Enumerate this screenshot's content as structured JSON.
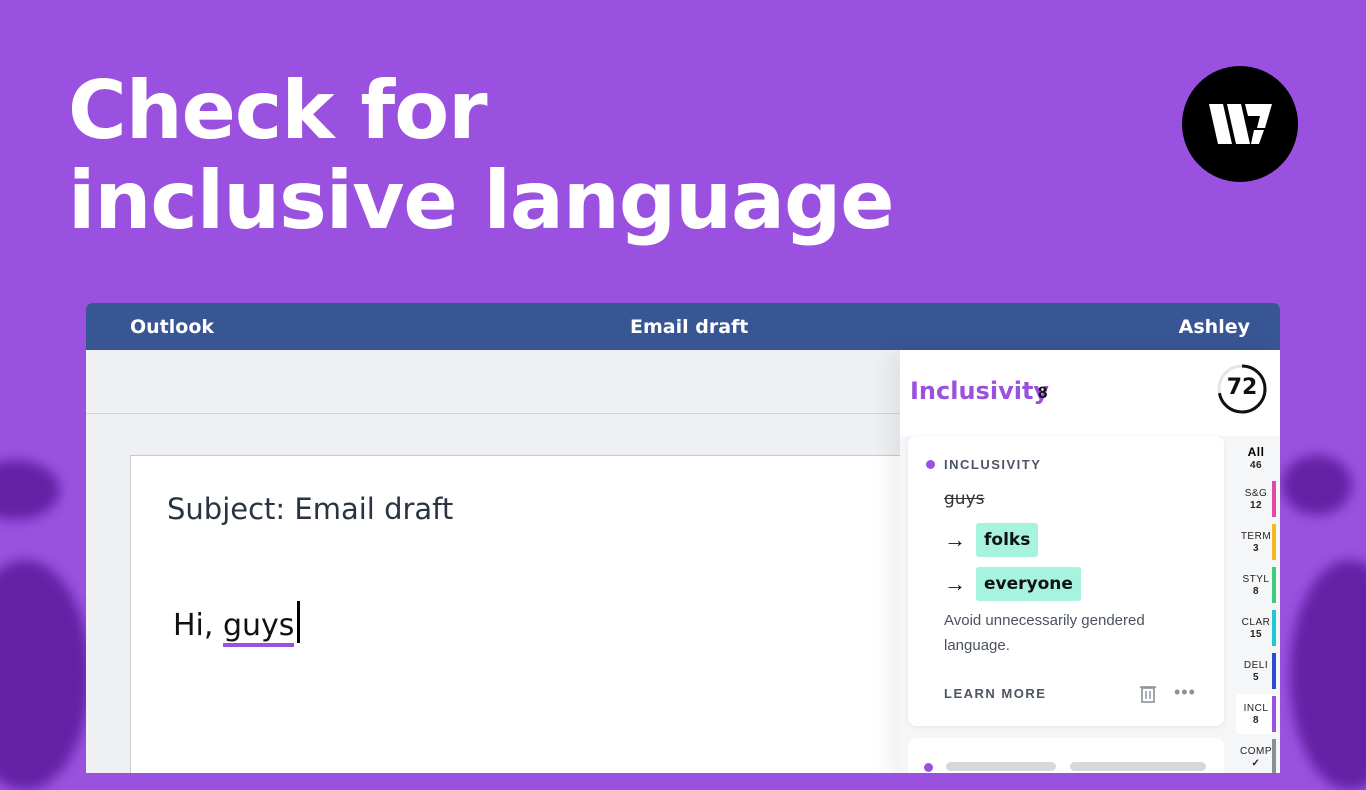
{
  "headline": {
    "line1": "Check for",
    "line2": "inclusive language"
  },
  "window": {
    "app": "Outlook",
    "title": "Email draft",
    "user": "Ashley"
  },
  "document": {
    "subject": "Subject: Email draft",
    "greeting": "Hi,",
    "flagged_word": "guys"
  },
  "panel": {
    "title": "Inclusivity",
    "count": "8",
    "score": "72",
    "card": {
      "category": "INCLUSIVITY",
      "original": "guys",
      "suggestions": [
        "folks",
        "everyone"
      ],
      "description": "Avoid unnecessarily gendered language.",
      "learn_more": "LEARN MORE"
    },
    "categories": [
      {
        "label": "All",
        "count": "46",
        "color": ""
      },
      {
        "label": "S&G",
        "count": "12",
        "color": "#e04aa8"
      },
      {
        "label": "TERM",
        "count": "3",
        "color": "#f5b71f"
      },
      {
        "label": "STYL",
        "count": "8",
        "color": "#3fcb7c"
      },
      {
        "label": "CLAR",
        "count": "15",
        "color": "#22c7d6"
      },
      {
        "label": "DELI",
        "count": "5",
        "color": "#2e4bd6"
      },
      {
        "label": "INCL",
        "count": "8",
        "color": "#9b51e0"
      },
      {
        "label": "COMP",
        "count": "✓",
        "color": "#8a8f96"
      }
    ]
  },
  "colors": {
    "background": "#9b51e0",
    "titlebar": "#385694",
    "accent": "#9b51e0",
    "chip": "#a6f3df"
  }
}
